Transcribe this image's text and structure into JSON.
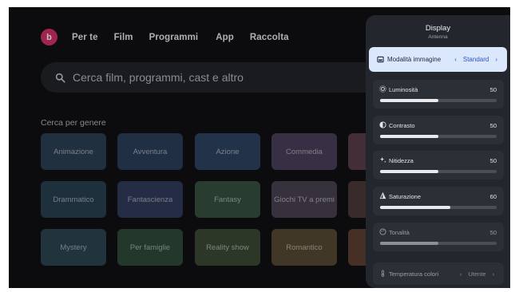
{
  "nav": {
    "avatar_letter": "b",
    "items": [
      "Per te",
      "Film",
      "Programmi",
      "App",
      "Raccolta"
    ]
  },
  "search": {
    "placeholder": "Cerca film, programmi, cast e altro"
  },
  "genres": {
    "section_label": "Cerca per genere",
    "rows": [
      [
        "Animazione",
        "Avventura",
        "Azione",
        "Commedia",
        ""
      ],
      [
        "Drammatico",
        "Fantascienza",
        "Fantasy",
        "Giochi TV a premi",
        ""
      ],
      [
        "Mystery",
        "Per famiglie",
        "Reality show",
        "Romantico",
        ""
      ]
    ]
  },
  "panel": {
    "title": "Display",
    "subtitle": "Antenna",
    "mode": {
      "label": "Modalità immagine",
      "value": "Standard"
    },
    "sliders": [
      {
        "label": "Luminosità",
        "value": "50",
        "level": 0.5
      },
      {
        "label": "Contrasto",
        "value": "50",
        "level": 0.5
      },
      {
        "label": "Nitidezza",
        "value": "50",
        "level": 0.5
      },
      {
        "label": "Saturazione",
        "value": "60",
        "level": 0.6
      },
      {
        "label": "Tonalità",
        "value": "50",
        "level": 0.5
      }
    ],
    "temperature": {
      "label": "Temperatura colori",
      "value": "Utente"
    }
  },
  "colors": {
    "avatar": "#d5326a",
    "mode_highlight": "#dbe7fb"
  }
}
